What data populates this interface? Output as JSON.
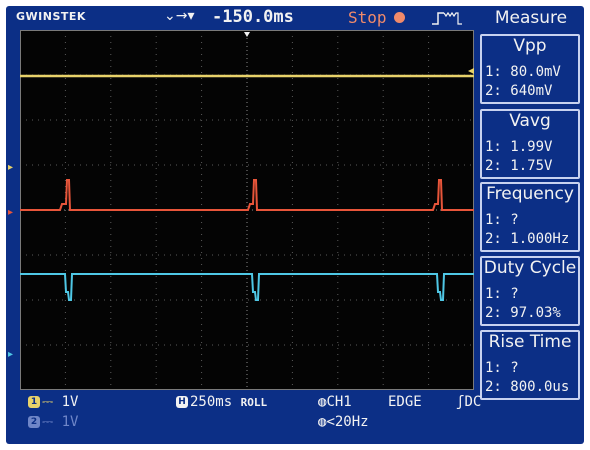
{
  "top": {
    "brand": "GWINSTEK",
    "time_position": "-150.0ms",
    "run_state": "Stop"
  },
  "measure": {
    "title": "Measure",
    "items": [
      {
        "name": "Vpp",
        "ch1": "1: 80.0mV",
        "ch2": "2: 640mV"
      },
      {
        "name": "Vavg",
        "ch1": "1: 1.99V",
        "ch2": "2: 1.75V"
      },
      {
        "name": "Frequency",
        "ch1": "1:   ?",
        "ch2": "2: 1.000Hz"
      },
      {
        "name": "Duty Cycle",
        "ch1": "1:   ?",
        "ch2": "2: 97.03%"
      },
      {
        "name": "Rise Time",
        "ch1": "1:   ?",
        "ch2": "2: 800.0us"
      }
    ]
  },
  "bottom": {
    "ch1_scale": "1V",
    "ch2_scale": "1V",
    "timebase": "250ms",
    "mode": "ROLL",
    "trigger_source": "CH1",
    "trigger_type": "EDGE",
    "coupling": "DC",
    "filter": "<20Hz"
  },
  "colors": {
    "ch1": "#e8d26a",
    "ch2": "#4fc8e6",
    "math": "#e8553a",
    "bezel": "#0c2f86"
  }
}
